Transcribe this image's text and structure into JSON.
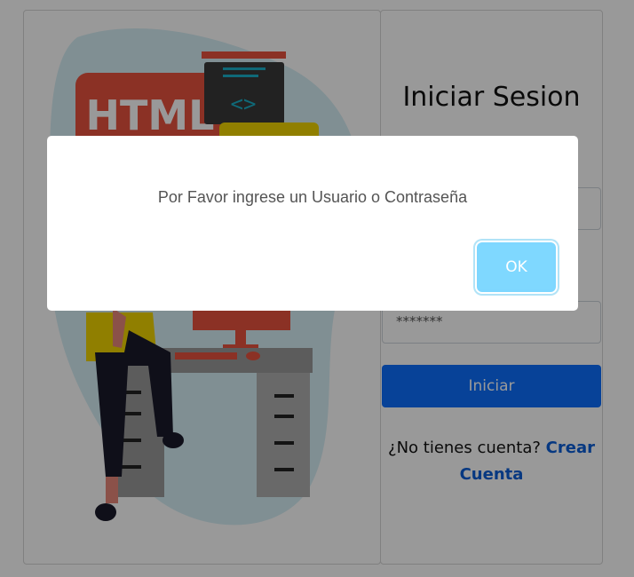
{
  "login": {
    "title": "Iniciar Sesion",
    "username_placeholder": "",
    "password_value": "*******",
    "submit_label": "Iniciar",
    "signup_prompt": "¿No tienes cuenta?",
    "signup_link": "Crear Cuenta"
  },
  "illustration": {
    "html_badge": "HTML",
    "code_icon": "<>"
  },
  "alert": {
    "message": "Por Favor ingrese un Usuario o Contraseña",
    "ok_label": "OK"
  },
  "colors": {
    "primary": "#0d6efd",
    "ok_button": "#7fd8ff",
    "html_badge": "#e8523f",
    "blob": "#d6eef5",
    "shirt": "#f0d400"
  }
}
